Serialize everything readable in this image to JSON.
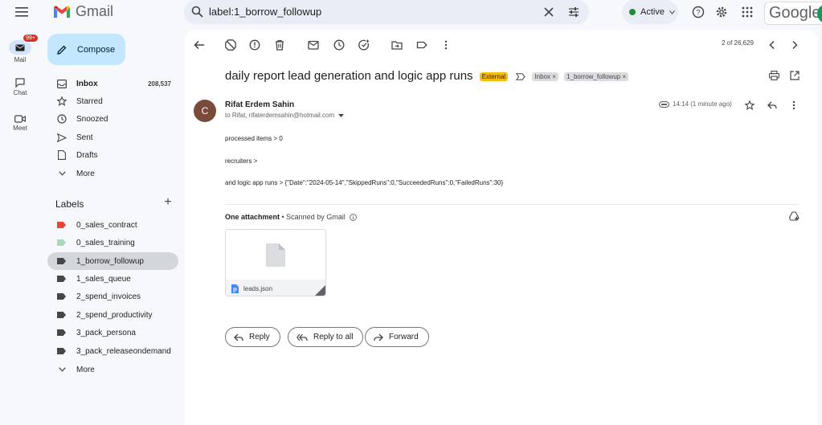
{
  "app": {
    "name": "Gmail",
    "brand_colors": [
      "#ea4335",
      "#4285f4",
      "#34a853",
      "#fbbc04"
    ]
  },
  "search": {
    "value": "label:1_borrow_followup"
  },
  "status": {
    "label": "Active",
    "color": "#1e8e3e"
  },
  "google_text": "Google",
  "rail": [
    {
      "label": "Mail",
      "badge": "99+",
      "icon": "mail-icon"
    },
    {
      "label": "Chat",
      "icon": "chat-icon"
    },
    {
      "label": "Meet",
      "icon": "video-icon"
    }
  ],
  "compose_label": "Compose",
  "nav": [
    {
      "label": "Inbox",
      "count": "208,537",
      "icon": "inbox-icon"
    },
    {
      "label": "Starred",
      "icon": "star-icon"
    },
    {
      "label": "Snoozed",
      "icon": "clock-icon"
    },
    {
      "label": "Sent",
      "icon": "send-icon"
    },
    {
      "label": "Drafts",
      "icon": "draft-icon"
    },
    {
      "label": "More",
      "icon": "chevron-down-icon"
    }
  ],
  "labels_heading": "Labels",
  "labels": [
    {
      "label": "0_sales_contract",
      "color": "#ea4335"
    },
    {
      "label": "0_sales_training",
      "color": "#a8dab5"
    },
    {
      "label": "1_borrow_followup",
      "color": "#444746"
    },
    {
      "label": "1_sales_queue",
      "color": "#444746"
    },
    {
      "label": "2_spend_invoices",
      "color": "#444746"
    },
    {
      "label": "2_spend_productivity",
      "color": "#444746"
    },
    {
      "label": "3_pack_persona",
      "color": "#444746"
    },
    {
      "label": "3_pack_releaseondemand",
      "color": "#444746"
    }
  ],
  "labels_more": "More",
  "pager": "2 of 26,629",
  "email": {
    "subject": "daily report lead generation and logic app runs",
    "external_chip": "External",
    "label_chips": [
      "Inbox",
      "1_borrow_followup"
    ],
    "avatar_letter": "C",
    "sender": "Rifat Erdem Sahin",
    "to": "to Rifat, rifaterdemsahin@hotmail.com",
    "time": "14:14 (1 minute ago)",
    "body": [
      "processed items > 0",
      "recruiters >",
      "and logic app runs > {\"Date\":\"2024-05-14\",\"SkippedRuns\":0,\"SucceededRuns\":0,\"FailedRuns\":30}"
    ],
    "attachment_heading": "One attachment",
    "scanned": " • Scanned by Gmail",
    "attachment_name": "leads.json"
  },
  "actions": {
    "reply": "Reply",
    "reply_all": "Reply to all",
    "forward": "Forward"
  }
}
